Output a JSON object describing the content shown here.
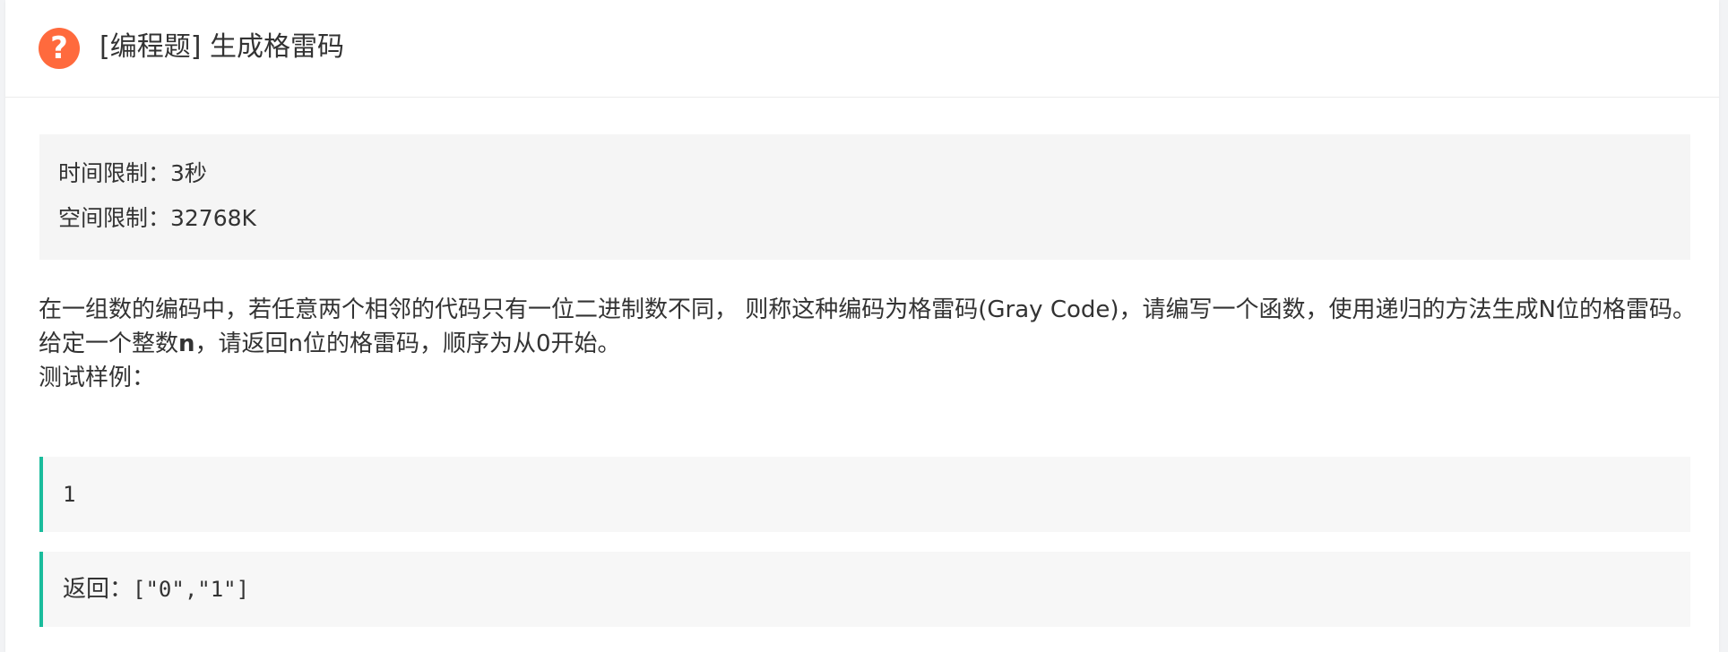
{
  "header": {
    "icon": "question-circle-icon",
    "icon_glyph": "?",
    "icon_color": "#ff6a3d",
    "title": "[编程题] 生成格雷码"
  },
  "limits": {
    "time": "时间限制：3秒",
    "memory": "空间限制：32768K"
  },
  "description": {
    "para1": "在一组数的编码中，若任意两个相邻的代码只有一位二进制数不同， 则称这种编码为格雷码(Gray Code)，请编写一个函数，使用递归的方法生成N位的格雷码。",
    "para2_before": "给定一个整数",
    "para2_bold": "n",
    "para2_after": "，请返回n位的格雷码，顺序为从0开始。",
    "para3": "测试样例："
  },
  "sample": {
    "input": "1",
    "return_label": "返回：",
    "return_value": "[\"0\",\"1\"]"
  },
  "colors": {
    "accent_border": "#1abc9c",
    "panel_bg": "#f5f5f5"
  }
}
